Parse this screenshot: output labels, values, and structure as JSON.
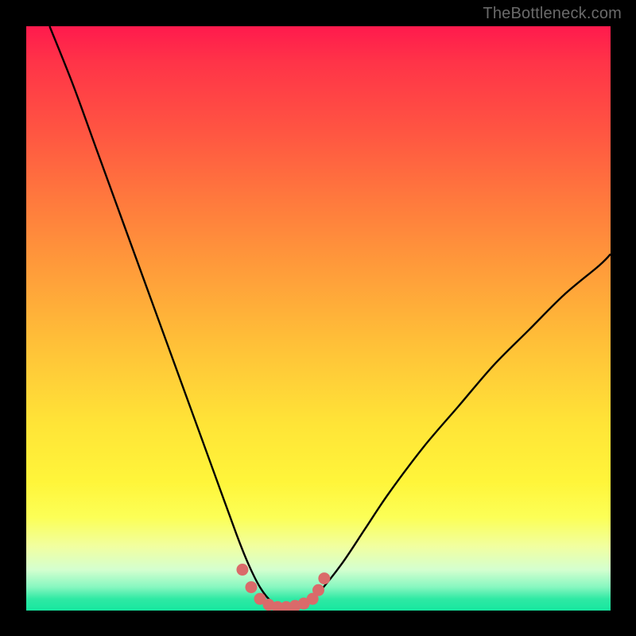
{
  "watermark": "TheBottleneck.com",
  "chart_data": {
    "type": "line",
    "title": "",
    "xlabel": "",
    "ylabel": "",
    "xlim": [
      0,
      100
    ],
    "ylim": [
      0,
      100
    ],
    "grid": false,
    "note": "Axes unlabeled; values are proportional (0–100) estimates read from geometry. The black curve is a V-shaped bottleneck curve reaching ~0 near x≈40–48. The pink/salmon dotted segment highlights the minimum region.",
    "series": [
      {
        "name": "bottleneck-curve",
        "color": "#000000",
        "x": [
          4,
          8,
          12,
          16,
          20,
          24,
          28,
          32,
          36,
          38,
          40,
          42,
          44,
          46,
          48,
          50,
          54,
          58,
          62,
          68,
          74,
          80,
          86,
          92,
          98,
          100
        ],
        "y": [
          100,
          90,
          79,
          68,
          57,
          46,
          35,
          24,
          13,
          8,
          4,
          1.5,
          0.5,
          0.5,
          1.2,
          3,
          8,
          14,
          20,
          28,
          35,
          42,
          48,
          54,
          59,
          61
        ]
      },
      {
        "name": "optimal-region-highlight",
        "color": "#da6a6a",
        "style": "dots",
        "x": [
          37,
          38.5,
          40,
          41.5,
          43,
          44.5,
          46,
          47.5,
          49,
          50,
          51
        ],
        "y": [
          7,
          4,
          2,
          1,
          0.6,
          0.6,
          0.8,
          1.2,
          2,
          3.5,
          5.5
        ]
      }
    ],
    "background_gradient": {
      "direction": "vertical",
      "stops": [
        {
          "pos": 0.0,
          "color": "#ff1a4d"
        },
        {
          "pos": 0.3,
          "color": "#ff7a3d"
        },
        {
          "pos": 0.68,
          "color": "#ffe437"
        },
        {
          "pos": 0.89,
          "color": "#f1ffa0"
        },
        {
          "pos": 1.0,
          "color": "#16e79f"
        }
      ]
    }
  }
}
